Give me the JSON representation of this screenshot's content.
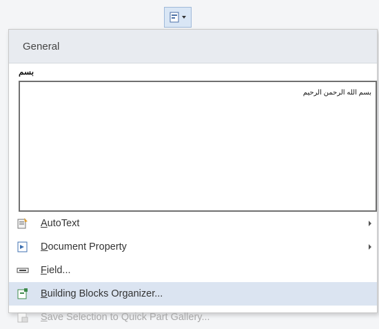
{
  "gallery": {
    "header": "General",
    "entry_name": "بسم",
    "preview_text": "بسم الله الرحمن الرحيم"
  },
  "menu": {
    "autotext": {
      "accel": "A",
      "rest": "utoText"
    },
    "document_property": {
      "accel": "D",
      "rest": "ocument Property"
    },
    "field": {
      "accel": "F",
      "rest": "ield..."
    },
    "building_blocks": {
      "accel": "B",
      "rest": "uilding Blocks Organizer..."
    },
    "save_selection": {
      "accel": "S",
      "rest": "ave Selection to Quick Part Gallery..."
    }
  },
  "colors": {
    "highlight": "#dbe4f1",
    "header_bg": "#e8ebf0",
    "button_bg": "#d9e6f5"
  },
  "icons": [
    "quick-parts-icon",
    "autotext-icon",
    "document-property-icon",
    "field-icon",
    "building-blocks-icon",
    "save-selection-icon"
  ]
}
